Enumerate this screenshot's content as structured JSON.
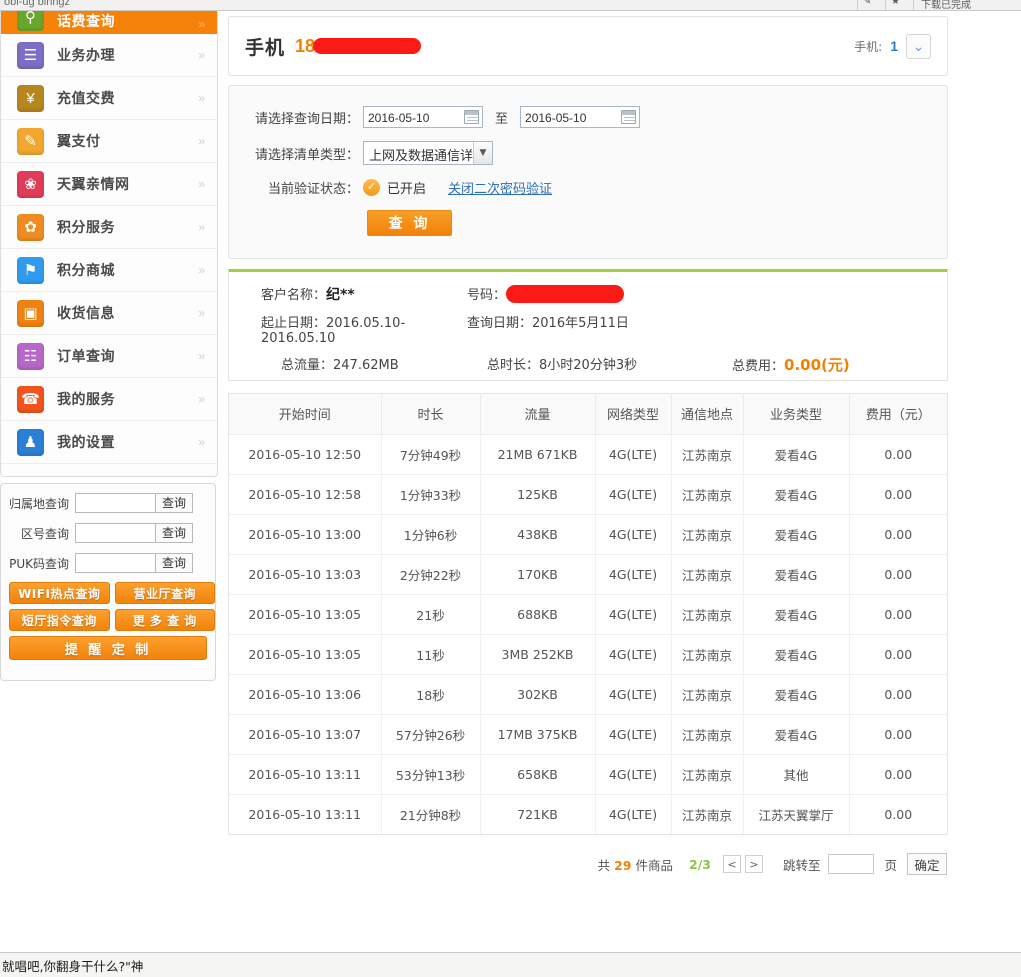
{
  "browser": {
    "tab_text": "obi-ug   binngz",
    "toolbar_right": "下载已完成"
  },
  "sidebar": {
    "items": [
      {
        "label": "话费查询",
        "icon": "search-icon",
        "icon_glyph": "⌕",
        "icon_color": "#6aa62b",
        "active": true
      },
      {
        "label": "业务办理",
        "icon": "clipboard-icon",
        "icon_glyph": "☰",
        "icon_color": "#7b6ec4",
        "active": false
      },
      {
        "label": "充值交费",
        "icon": "yuan-coin-icon",
        "icon_glyph": "¥",
        "icon_color": "#b8861e",
        "active": false
      },
      {
        "label": "翼支付",
        "icon": "wallet-icon",
        "icon_glyph": "✎",
        "icon_color": "#f0a830",
        "active": false
      },
      {
        "label": "天翼亲情网",
        "icon": "family-network-icon",
        "icon_glyph": "❀",
        "icon_color": "#e03c5a",
        "active": false
      },
      {
        "label": "积分服务",
        "icon": "points-gift-icon",
        "icon_glyph": "✿",
        "icon_color": "#ef8b20",
        "active": false
      },
      {
        "label": "积分商城",
        "icon": "points-mall-icon",
        "icon_glyph": "⚑",
        "icon_color": "#2f9bef",
        "active": false
      },
      {
        "label": "收货信息",
        "icon": "box-icon",
        "icon_glyph": "▣",
        "icon_color": "#ef8212",
        "active": false
      },
      {
        "label": "订单查询",
        "icon": "order-list-icon",
        "icon_glyph": "☷",
        "icon_color": "#b667c8",
        "active": false
      },
      {
        "label": "我的服务",
        "icon": "phone-icon",
        "icon_glyph": "☎",
        "icon_color": "#f2541b",
        "active": false
      },
      {
        "label": "我的设置",
        "icon": "user-icon",
        "icon_glyph": "♟",
        "icon_color": "#2b7fd4",
        "active": false
      }
    ],
    "chevron": "»",
    "query_rows": [
      {
        "label": "归属地查询",
        "value": "",
        "button": "查询"
      },
      {
        "label": "区号查询",
        "value": "",
        "button": "查询"
      },
      {
        "label": "PUK码查询",
        "value": "",
        "button": "查询"
      }
    ],
    "orange_buttons": [
      "WIFI热点查询",
      "营业厅查询",
      "短厅指令查询",
      "更 多 查 询"
    ],
    "remind_button": "提 醒 定 制"
  },
  "header": {
    "phone_label": "手机",
    "phone_prefix": "18",
    "count_label": "手机:",
    "count_value": "1",
    "expand_icon": "⌄⌄"
  },
  "query_form": {
    "date_label": "请选择查询日期：",
    "date_from": "2016-05-10",
    "date_to": "2016-05-10",
    "to_word": "至",
    "type_label": "请选择清单类型：",
    "type_value": "上网及数据通信详单",
    "status_label": "当前验证状态：",
    "status_value": "已开启",
    "close_link": "关闭二次密码验证",
    "submit": "查 询"
  },
  "summary": {
    "customer_label": "客户名称：",
    "customer_value": "纪**",
    "number_label": "号码：",
    "number_value": "",
    "period_label": "起止日期：",
    "period_value": "2016.05.10-2016.05.10",
    "querydate_label": "查询日期：",
    "querydate_value": "2016年5月11日",
    "traffic_label": "总流量：",
    "traffic_value": "247.62MB",
    "duration_label": "总时长：",
    "duration_value": "8小时20分钟3秒",
    "fee_label": "总费用：",
    "fee_value": "0.00",
    "fee_unit": "(元)"
  },
  "table": {
    "headers": [
      "开始时间",
      "时长",
      "流量",
      "网络类型",
      "通信地点",
      "业务类型",
      "费用（元）"
    ],
    "rows": [
      [
        "2016-05-10 12:50",
        "7分钟49秒",
        "21MB 671KB",
        "4G(LTE)",
        "江苏南京",
        "爱看4G",
        "0.00"
      ],
      [
        "2016-05-10 12:58",
        "1分钟33秒",
        "125KB",
        "4G(LTE)",
        "江苏南京",
        "爱看4G",
        "0.00"
      ],
      [
        "2016-05-10 13:00",
        "1分钟6秒",
        "438KB",
        "4G(LTE)",
        "江苏南京",
        "爱看4G",
        "0.00"
      ],
      [
        "2016-05-10 13:03",
        "2分钟22秒",
        "170KB",
        "4G(LTE)",
        "江苏南京",
        "爱看4G",
        "0.00"
      ],
      [
        "2016-05-10 13:05",
        "21秒",
        "688KB",
        "4G(LTE)",
        "江苏南京",
        "爱看4G",
        "0.00"
      ],
      [
        "2016-05-10 13:05",
        "11秒",
        "3MB 252KB",
        "4G(LTE)",
        "江苏南京",
        "爱看4G",
        "0.00"
      ],
      [
        "2016-05-10 13:06",
        "18秒",
        "302KB",
        "4G(LTE)",
        "江苏南京",
        "爱看4G",
        "0.00"
      ],
      [
        "2016-05-10 13:07",
        "57分钟26秒",
        "17MB 375KB",
        "4G(LTE)",
        "江苏南京",
        "爱看4G",
        "0.00"
      ],
      [
        "2016-05-10 13:11",
        "53分钟13秒",
        "658KB",
        "4G(LTE)",
        "江苏南京",
        "其他",
        "0.00"
      ],
      [
        "2016-05-10 13:11",
        "21分钟8秒",
        "721KB",
        "4G(LTE)",
        "江苏南京",
        "江苏天翼掌厅",
        "0.00"
      ]
    ]
  },
  "pagination": {
    "total_prefix": "共",
    "total_count": "29",
    "total_suffix": "件商品",
    "current_page": "2",
    "page_sep": "/",
    "total_pages": "3",
    "prev": "<",
    "next": ">",
    "jump_label": "跳转至",
    "jump_value": "",
    "page_unit": "页",
    "confirm": "确定"
  },
  "statusbar": {
    "text": "就唱吧,你翻身干什么?\"神"
  },
  "colors": {
    "accent_orange": "#f7820a",
    "link_blue": "#2f6fb3",
    "green_border": "#9fd243",
    "redaction_red": "#fb1a16"
  }
}
